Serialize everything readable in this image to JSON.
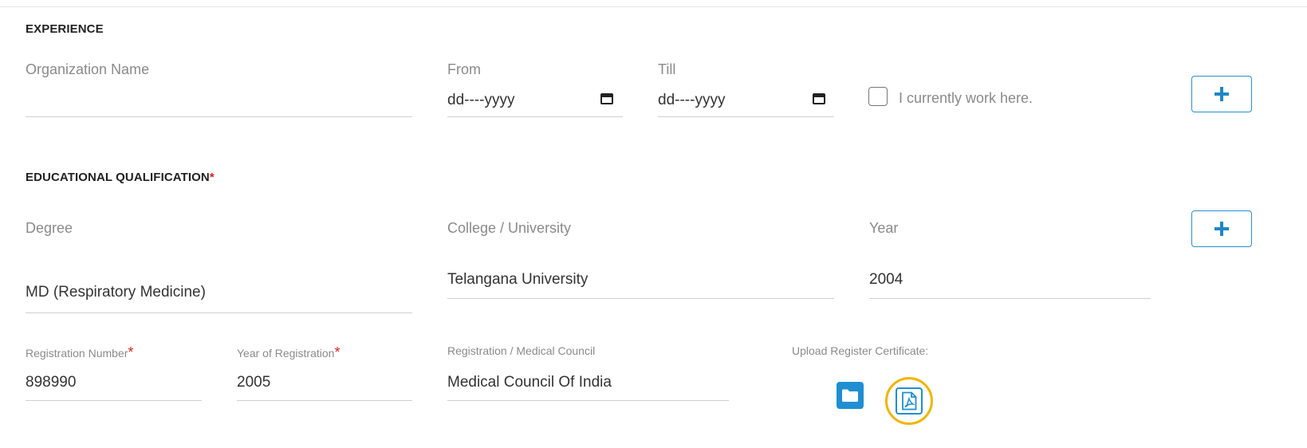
{
  "experience": {
    "title": "EXPERIENCE",
    "organization_label": "Organization Name",
    "organization_value": "",
    "from_label": "From",
    "from_placeholder": "dd----yyyy",
    "till_label": "Till",
    "till_placeholder": "dd----yyyy",
    "current_label": "I currently work here.",
    "current_checked": false
  },
  "education": {
    "title": "EDUCATIONAL QUALIFICATION",
    "required_mark": "*",
    "degree_label": "Degree",
    "degree_value": "MD (Respiratory Medicine)",
    "college_label": "College / University",
    "college_value": "Telangana University",
    "year_label": "Year",
    "year_value": "2004"
  },
  "registration": {
    "number_label": "Registration Number",
    "number_value": "898990",
    "year_label": "Year of Registration",
    "year_value": "2005",
    "council_label": "Registration / Medical Council",
    "council_value": "Medical Council Of India",
    "required_mark": "*",
    "upload_label": "Upload Register Certificate:"
  },
  "icons": {
    "add": "plus-icon",
    "calendar": "calendar-icon",
    "folder": "folder-icon",
    "pdf": "pdf-icon"
  },
  "colors": {
    "accent": "#1f8fd2",
    "required": "#e0201c",
    "highlight": "#f2b400"
  }
}
